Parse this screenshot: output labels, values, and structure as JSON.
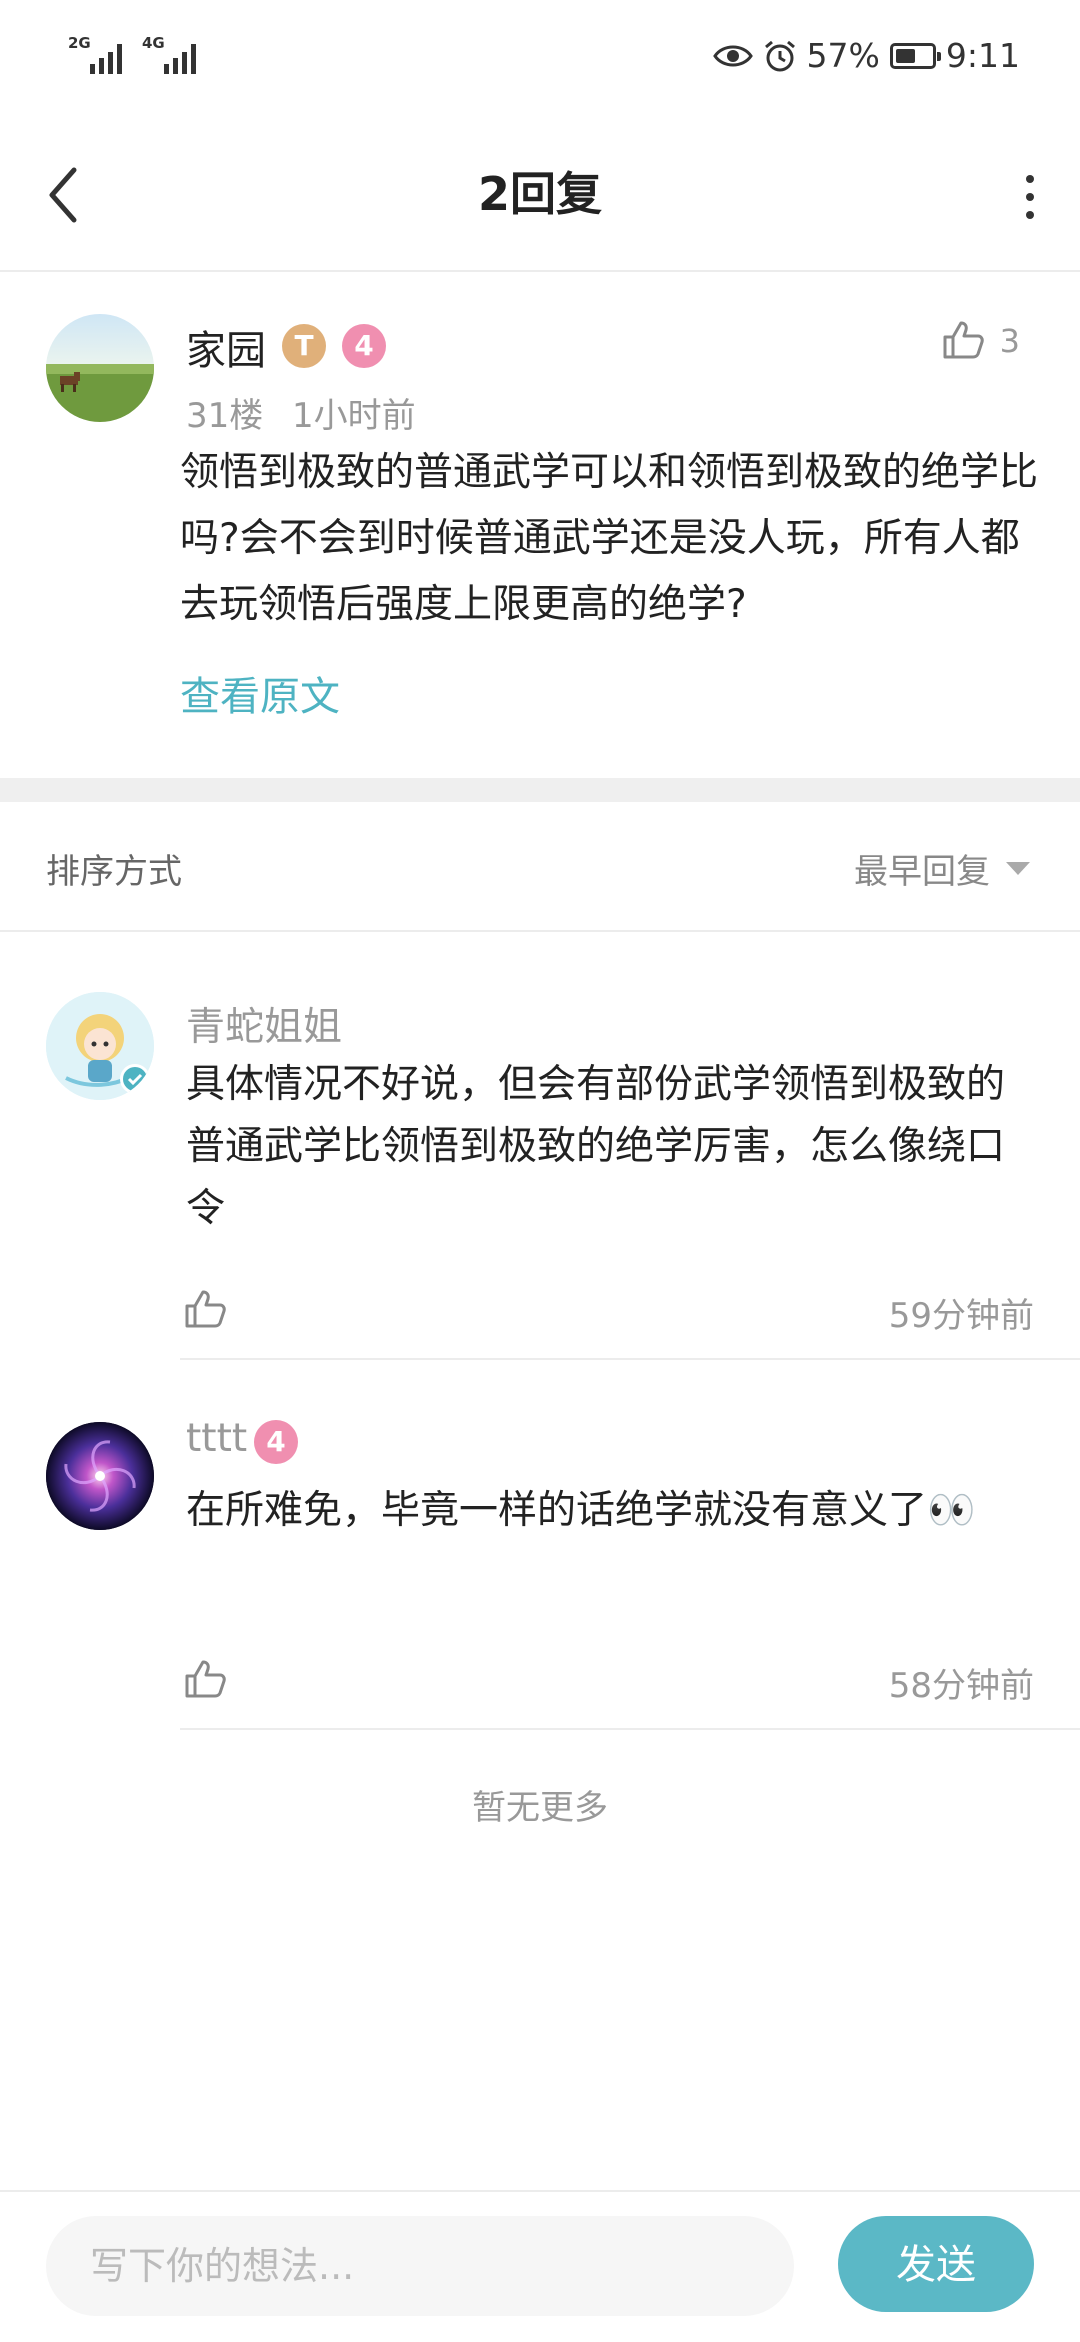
{
  "status_bar": {
    "network_1": "2G",
    "network_2": "4G",
    "battery_percent": "57%",
    "time": "9:11",
    "battery_level": 0.57
  },
  "nav": {
    "title": "2回复"
  },
  "post": {
    "username": "家园",
    "badge_t": "T",
    "badge_level": "4",
    "floor": "31楼",
    "time": "1小时前",
    "like_count": "3",
    "content": "领悟到极致的普通武学可以和领悟到极致的绝学比吗?会不会到时候普通武学还是没人玩，所有人都去玩领悟后强度上限更高的绝学?",
    "view_original": "查看原文"
  },
  "sort": {
    "label": "排序方式",
    "value": "最早回复"
  },
  "comments": [
    {
      "username": "青蛇姐姐",
      "content": "具体情况不好说，但会有部份武学领悟到极致的普通武学比领悟到极致的绝学厉害，怎么像绕口令",
      "time": "59分钟前"
    },
    {
      "username": "tttt",
      "badge_level": "4",
      "content": "在所难免，毕竟一样的话绝学就没有意义了👀",
      "time": "58分钟前"
    }
  ],
  "no_more": "暂无更多",
  "input": {
    "placeholder": "写下你的想法...",
    "send_label": "发送"
  },
  "colors": {
    "accent": "#5bb8c6",
    "link": "#4eb3c2",
    "badge_pink": "#f08fb0",
    "badge_gold": "#e0b07a"
  }
}
